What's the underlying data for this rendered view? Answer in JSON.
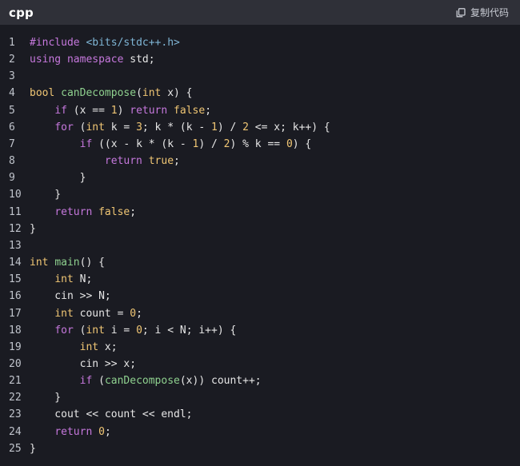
{
  "header": {
    "language": "cpp",
    "copy_label": "复制代码",
    "copy_icon": "copy-icon"
  },
  "colors": {
    "background": "#1a1b22",
    "header_background": "#2f3038",
    "keyword": "#c678dd",
    "type": "#f0c674",
    "include_path": "#7fb5d5",
    "function": "#8fd18f",
    "number": "#f0c674",
    "plain": "#e6e6e6",
    "line_number": "#c0c4cc"
  },
  "code": {
    "lines": [
      {
        "n": "1",
        "tokens": [
          [
            "pp",
            "#include "
          ],
          [
            "inc",
            "<bits/stdc++.h>"
          ]
        ]
      },
      {
        "n": "2",
        "tokens": [
          [
            "kw",
            "using"
          ],
          [
            "plain",
            " "
          ],
          [
            "kw",
            "namespace"
          ],
          [
            "plain",
            " std;"
          ]
        ]
      },
      {
        "n": "3",
        "tokens": []
      },
      {
        "n": "4",
        "tokens": [
          [
            "type",
            "bool"
          ],
          [
            "plain",
            " "
          ],
          [
            "fn",
            "canDecompose"
          ],
          [
            "plain",
            "("
          ],
          [
            "type",
            "int"
          ],
          [
            "plain",
            " x) {"
          ]
        ]
      },
      {
        "n": "5",
        "tokens": [
          [
            "plain",
            "    "
          ],
          [
            "kw",
            "if"
          ],
          [
            "plain",
            " (x == "
          ],
          [
            "num",
            "1"
          ],
          [
            "plain",
            ") "
          ],
          [
            "kw",
            "return"
          ],
          [
            "plain",
            " "
          ],
          [
            "lit",
            "false"
          ],
          [
            "plain",
            ";"
          ]
        ]
      },
      {
        "n": "6",
        "tokens": [
          [
            "plain",
            "    "
          ],
          [
            "kw",
            "for"
          ],
          [
            "plain",
            " ("
          ],
          [
            "type",
            "int"
          ],
          [
            "plain",
            " k = "
          ],
          [
            "num",
            "3"
          ],
          [
            "plain",
            "; k * (k - "
          ],
          [
            "num",
            "1"
          ],
          [
            "plain",
            ") / "
          ],
          [
            "num",
            "2"
          ],
          [
            "plain",
            " <= x; k++) {"
          ]
        ]
      },
      {
        "n": "7",
        "tokens": [
          [
            "plain",
            "        "
          ],
          [
            "kw",
            "if"
          ],
          [
            "plain",
            " ((x - k * (k - "
          ],
          [
            "num",
            "1"
          ],
          [
            "plain",
            ") / "
          ],
          [
            "num",
            "2"
          ],
          [
            "plain",
            ") % k == "
          ],
          [
            "num",
            "0"
          ],
          [
            "plain",
            ") {"
          ]
        ]
      },
      {
        "n": "8",
        "tokens": [
          [
            "plain",
            "            "
          ],
          [
            "kw",
            "return"
          ],
          [
            "plain",
            " "
          ],
          [
            "lit",
            "true"
          ],
          [
            "plain",
            ";"
          ]
        ]
      },
      {
        "n": "9",
        "tokens": [
          [
            "plain",
            "        }"
          ]
        ]
      },
      {
        "n": "10",
        "tokens": [
          [
            "plain",
            "    }"
          ]
        ]
      },
      {
        "n": "11",
        "tokens": [
          [
            "plain",
            "    "
          ],
          [
            "kw",
            "return"
          ],
          [
            "plain",
            " "
          ],
          [
            "lit",
            "false"
          ],
          [
            "plain",
            ";"
          ]
        ]
      },
      {
        "n": "12",
        "tokens": [
          [
            "plain",
            "}"
          ]
        ]
      },
      {
        "n": "13",
        "tokens": []
      },
      {
        "n": "14",
        "tokens": [
          [
            "type",
            "int"
          ],
          [
            "plain",
            " "
          ],
          [
            "fn",
            "main"
          ],
          [
            "plain",
            "() {"
          ]
        ]
      },
      {
        "n": "15",
        "tokens": [
          [
            "plain",
            "    "
          ],
          [
            "type",
            "int"
          ],
          [
            "plain",
            " N;"
          ]
        ]
      },
      {
        "n": "16",
        "tokens": [
          [
            "plain",
            "    cin >> N;"
          ]
        ]
      },
      {
        "n": "17",
        "tokens": [
          [
            "plain",
            "    "
          ],
          [
            "type",
            "int"
          ],
          [
            "plain",
            " count = "
          ],
          [
            "num",
            "0"
          ],
          [
            "plain",
            ";"
          ]
        ]
      },
      {
        "n": "18",
        "tokens": [
          [
            "plain",
            "    "
          ],
          [
            "kw",
            "for"
          ],
          [
            "plain",
            " ("
          ],
          [
            "type",
            "int"
          ],
          [
            "plain",
            " i = "
          ],
          [
            "num",
            "0"
          ],
          [
            "plain",
            "; i < N; i++) {"
          ]
        ]
      },
      {
        "n": "19",
        "tokens": [
          [
            "plain",
            "        "
          ],
          [
            "type",
            "int"
          ],
          [
            "plain",
            " x;"
          ]
        ]
      },
      {
        "n": "20",
        "tokens": [
          [
            "plain",
            "        cin >> x;"
          ]
        ]
      },
      {
        "n": "21",
        "tokens": [
          [
            "plain",
            "        "
          ],
          [
            "kw",
            "if"
          ],
          [
            "plain",
            " ("
          ],
          [
            "fn",
            "canDecompose"
          ],
          [
            "plain",
            "(x)) count++;"
          ]
        ]
      },
      {
        "n": "22",
        "tokens": [
          [
            "plain",
            "    }"
          ]
        ]
      },
      {
        "n": "23",
        "tokens": [
          [
            "plain",
            "    cout << count << endl;"
          ]
        ]
      },
      {
        "n": "24",
        "tokens": [
          [
            "plain",
            "    "
          ],
          [
            "kw",
            "return"
          ],
          [
            "plain",
            " "
          ],
          [
            "num",
            "0"
          ],
          [
            "plain",
            ";"
          ]
        ]
      },
      {
        "n": "25",
        "tokens": [
          [
            "plain",
            "}"
          ]
        ]
      }
    ]
  }
}
